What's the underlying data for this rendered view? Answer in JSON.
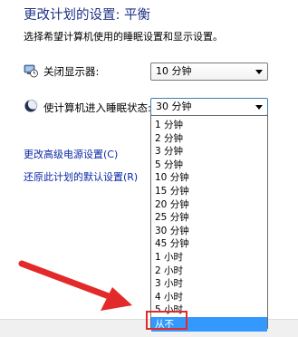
{
  "header": {
    "title": "更改计划的设置: 平衡",
    "description": "选择希望计算机使用的睡眠设置和显示设置。"
  },
  "display_off": {
    "label": "关闭显示器:",
    "value": "10 分钟",
    "icon": "monitor-clock-icon"
  },
  "sleep": {
    "label": "使计算机进入睡眠状态:",
    "value": "30 分钟",
    "icon": "moon-icon",
    "options": [
      "1 分钟",
      "2 分钟",
      "3 分钟",
      "5 分钟",
      "10 分钟",
      "15 分钟",
      "20 分钟",
      "25 分钟",
      "30 分钟",
      "45 分钟",
      "1 小时",
      "2 小时",
      "3 小时",
      "4 小时",
      "5 小时",
      "从不"
    ],
    "highlighted_option": "从不"
  },
  "links": {
    "advanced": "更改高级电源设置(C)",
    "restore": "还原此计划的默认设置(R)"
  },
  "colors": {
    "title": "#1e3287",
    "link": "#0a28a6",
    "selection": "#3399ff",
    "annotation": "#e32a2a"
  }
}
